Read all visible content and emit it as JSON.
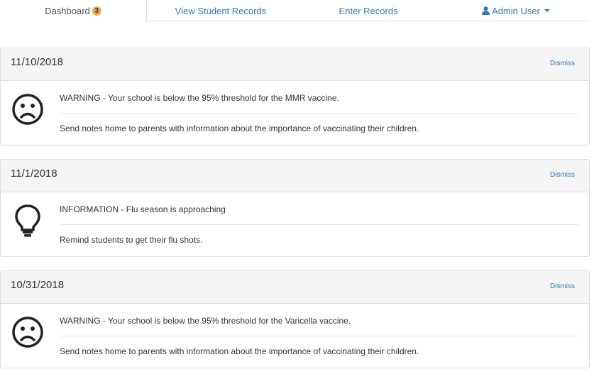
{
  "nav": {
    "tabs": [
      {
        "label": "Dashboard",
        "badge": "3"
      },
      {
        "label": "View Student Records"
      },
      {
        "label": "Enter Records"
      }
    ],
    "user": {
      "label": "Admin User",
      "icon": "user-icon"
    }
  },
  "alerts": [
    {
      "date": "11/10/2018",
      "dismiss": "Dismiss",
      "icon": "frown-face-icon",
      "title": "WARNING - Your school is below the 95% threshold for the MMR vaccine.",
      "detail": "Send notes home to parents with information about the importance of vaccinating their children."
    },
    {
      "date": "11/1/2018",
      "dismiss": "Dismiss",
      "icon": "lightbulb-icon",
      "title": "INFORMATION - Flu season is approaching",
      "detail": "Remind students to get their flu shots."
    },
    {
      "date": "10/31/2018",
      "dismiss": "Dismiss",
      "icon": "frown-face-icon",
      "title": "WARNING - Your school is below the 95% threshold for the Varicella vaccine.",
      "detail": "Send notes home to parents with information about the importance of vaccinating their children."
    }
  ],
  "colors": {
    "link": "#337ab7",
    "badge": "#f0ad4e",
    "panel_heading": "#f5f5f5",
    "border": "#dddddd"
  }
}
